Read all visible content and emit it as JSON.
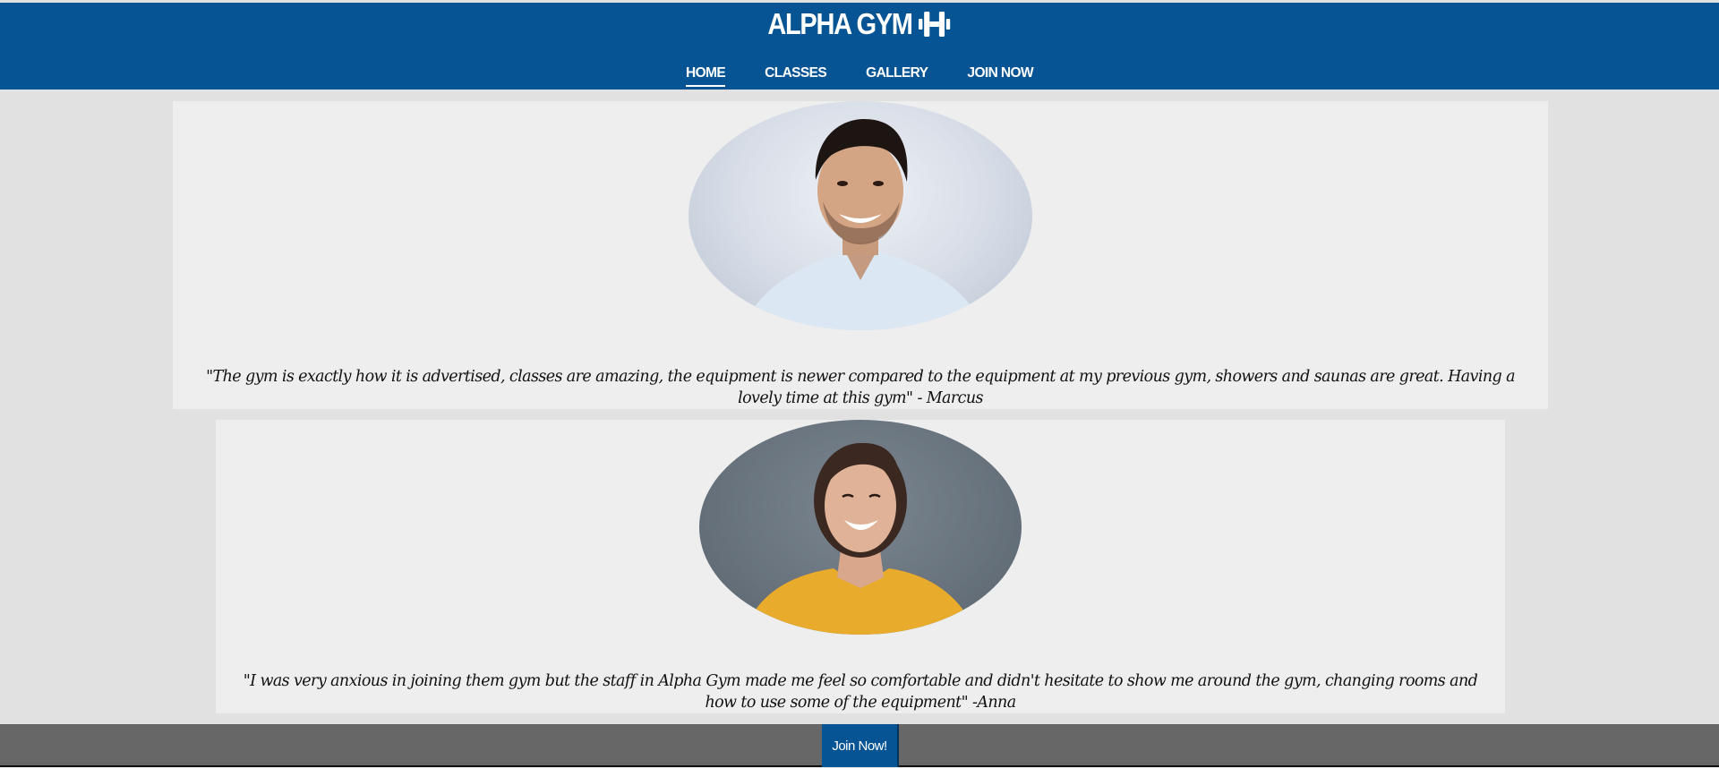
{
  "header": {
    "brand": "ALPHA GYM",
    "brand_icon": "dumbbell-icon",
    "nav": [
      {
        "label": "HOME",
        "active": true
      },
      {
        "label": "CLASSES",
        "active": false
      },
      {
        "label": "GALLERY",
        "active": false
      },
      {
        "label": "JOIN NOW",
        "active": false
      }
    ]
  },
  "testimonials": [
    {
      "photo_alt": "smiling man portrait",
      "quote": "\"The gym is exactly how it is advertised, classes are amazing, the equipment is newer compared to the equipment at my previous gym, showers and saunas are great. Having a lovely time at this gym\" - Marcus"
    },
    {
      "photo_alt": "laughing woman portrait",
      "quote": "\"I was very anxious in joining them gym but the staff in Alpha Gym made me feel so comfortable and didn't hesitate to show me around the gym, changing rooms and how to use some of the equipment\" -Anna"
    }
  ],
  "footer": {
    "join_button": "Join Now!"
  },
  "colors": {
    "brand_blue": "#075495",
    "page_bg": "#e1e1e1",
    "card_bg": "#eeeeee",
    "footer_bg": "#676767"
  }
}
